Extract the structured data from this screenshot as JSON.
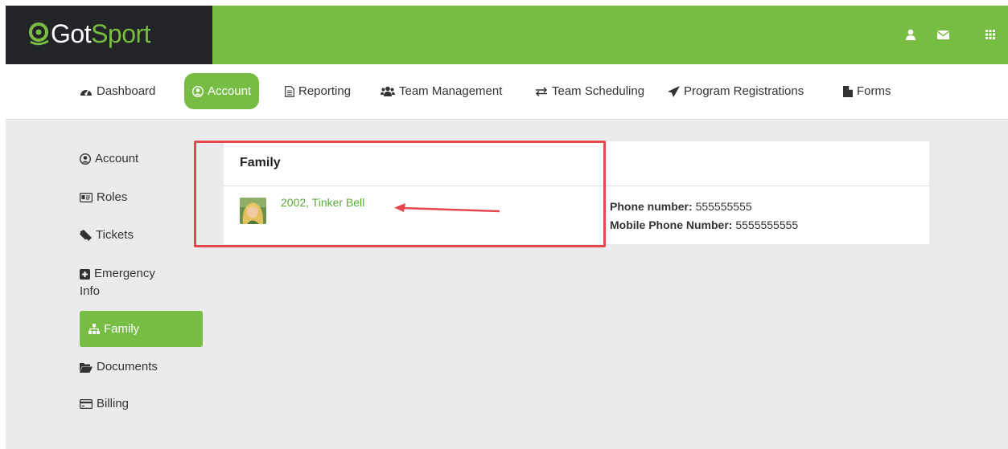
{
  "brand": {
    "got": "Got",
    "sport": "Sport"
  },
  "header": {
    "icons": [
      "user-icon",
      "envelope-icon",
      "grid-icon"
    ]
  },
  "nav": {
    "items": [
      {
        "label": "Dashboard",
        "icon": "dashboard-icon",
        "active": false
      },
      {
        "label": "Account",
        "icon": "user-circle-icon",
        "active": true
      },
      {
        "label": "Reporting",
        "icon": "file-text-icon",
        "active": false
      },
      {
        "label": "Team Management",
        "icon": "users-icon",
        "active": false
      },
      {
        "label": "Team Scheduling",
        "icon": "exchange-icon",
        "active": false
      },
      {
        "label": "Program Registrations",
        "icon": "paper-plane-icon",
        "active": false
      },
      {
        "label": "Forms",
        "icon": "file-icon",
        "active": false
      }
    ]
  },
  "sidebar": {
    "items": [
      {
        "label": "Account",
        "icon": "user-circle-icon",
        "active": false
      },
      {
        "label": "Roles",
        "icon": "id-card-icon",
        "active": false
      },
      {
        "label": "Tickets",
        "icon": "ticket-icon",
        "active": false
      },
      {
        "label_line1": "Emergency",
        "label_line2": "Info",
        "icon": "plus-square-icon",
        "active": false
      },
      {
        "label": "Family",
        "icon": "sitemap-icon",
        "active": true
      },
      {
        "label": "Documents",
        "icon": "folder-open-icon",
        "active": false
      },
      {
        "label": "Billing",
        "icon": "credit-card-icon",
        "active": false
      }
    ]
  },
  "family": {
    "title": "Family",
    "member": {
      "label": "2002, Tinker Bell",
      "avatar": "avatar-image"
    },
    "phone_label": "Phone number:",
    "phone_value": "555555555",
    "mobile_label": "Mobile Phone Number:",
    "mobile_value": "5555555555"
  },
  "colors": {
    "brand_green": "#78bd43",
    "dark": "#222427",
    "link_green": "#5bab3b",
    "highlight_red": "#e5474d",
    "content_bg": "#ebebee"
  }
}
